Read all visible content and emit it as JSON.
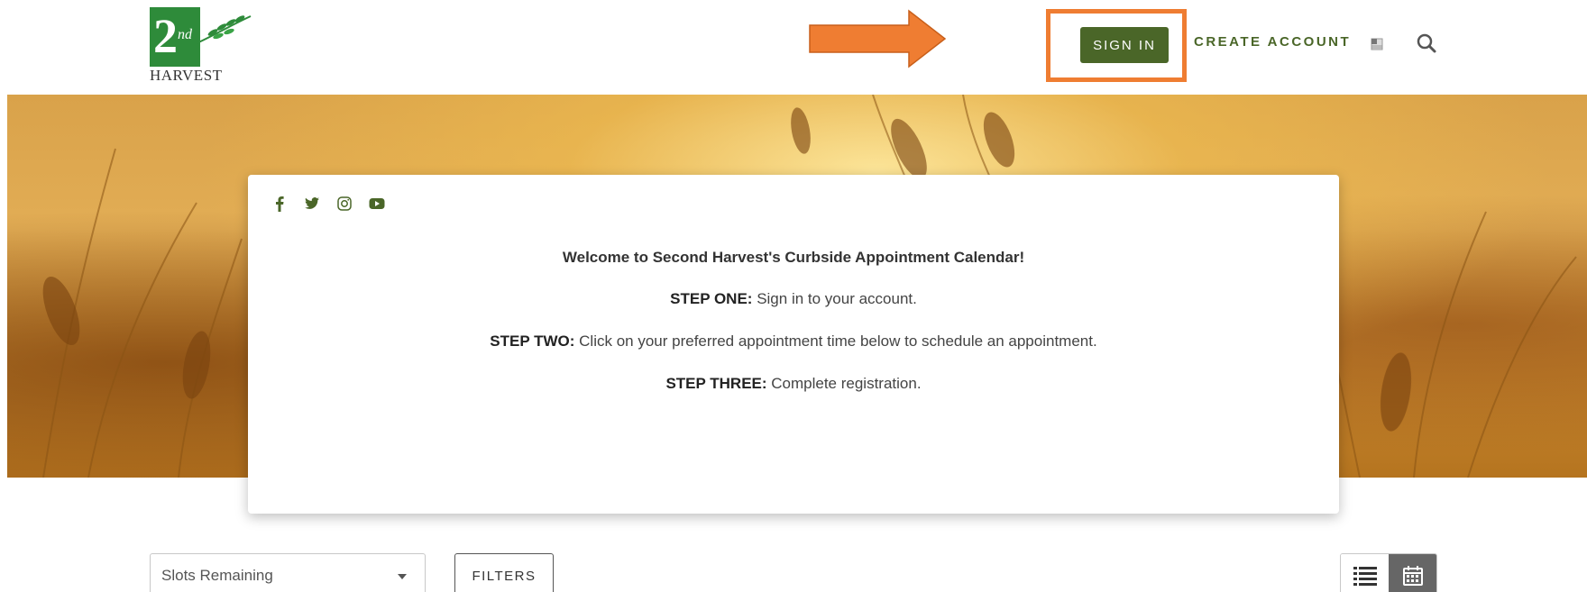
{
  "header": {
    "logo_number": "2",
    "logo_superscript": "nd",
    "logo_text": "HARVEST",
    "sign_in_label": "SIGN IN",
    "create_account_label": "CREATE ACCOUNT",
    "language_icon": "language-flag-icon",
    "search_icon": "search-icon"
  },
  "annotations": {
    "arrow_color": "#ef7d32",
    "highlight_color": "#ef7d32"
  },
  "card": {
    "social_icons": [
      "facebook-icon",
      "twitter-icon",
      "instagram-icon",
      "youtube-icon"
    ],
    "welcome": "Welcome to Second Harvest's Curbside Appointment Calendar!",
    "steps": [
      {
        "label": "STEP ONE:",
        "text": " Sign in to your account."
      },
      {
        "label": "STEP TWO:",
        "text": " Click on your preferred appointment time below to schedule an appointment."
      },
      {
        "label": "STEP THREE:",
        "text": " Complete registration."
      }
    ]
  },
  "controls": {
    "sort_select_value": "Slots Remaining",
    "filters_label": "FILTERS",
    "view_list_icon": "list-view-icon",
    "view_calendar_icon": "calendar-view-icon"
  },
  "colors": {
    "brand_green": "#4a6628",
    "logo_green": "#2e8b3a",
    "accent_orange": "#ef7d32"
  }
}
